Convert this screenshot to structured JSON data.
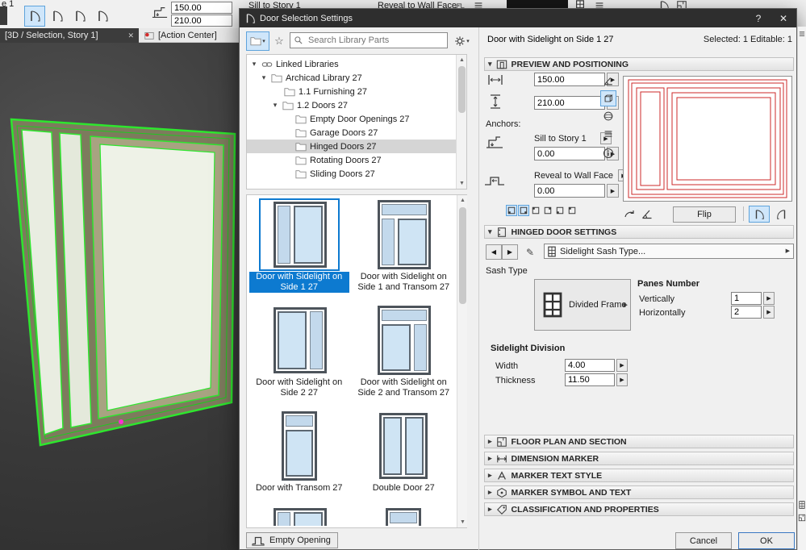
{
  "icons": {
    "chevron_down": "▾",
    "chevron_right": "▸",
    "arrow_left": "◀",
    "arrow_right": "▶",
    "flyout": "▶",
    "star": "☆",
    "pencil": "✎",
    "scroll_up": "▲",
    "scroll_down": "▼"
  },
  "topbar": {
    "corner_label": "e 1",
    "width_value": "150.00",
    "height_value": "210.00",
    "sill_label": "Sill to Story 1",
    "reveal_label": "Reveal to Wall Face"
  },
  "viewport": {
    "tab_label": "[3D / Selection, Story 1]",
    "tab_close": "✕",
    "action_center_label": "[Action Center]"
  },
  "dialog": {
    "title": "Door Selection Settings",
    "help_label": "?",
    "close_label": "✕"
  },
  "library": {
    "search_placeholder": "Search Library Parts",
    "tree": [
      {
        "label": "Linked Libraries"
      },
      {
        "label": "Archicad Library 27"
      },
      {
        "label": "1.1 Furnishing 27"
      },
      {
        "label": "1.2 Doors 27"
      },
      {
        "label": "Empty Door Openings 27"
      },
      {
        "label": "Garage Doors 27"
      },
      {
        "label": "Hinged Doors 27"
      },
      {
        "label": "Rotating Doors 27"
      },
      {
        "label": "Sliding Doors 27"
      }
    ],
    "items": [
      {
        "label": "Door with Sidelight on Side 1 27"
      },
      {
        "label": "Door with Sidelight on Side 1 and Transom 27"
      },
      {
        "label": "Door with Sidelight on Side 2 27"
      },
      {
        "label": "Door with Sidelight on Side 2 and Transom 27"
      },
      {
        "label": "Door with Transom 27"
      },
      {
        "label": "Double Door 27"
      }
    ],
    "empty_opening_label": "Empty Opening"
  },
  "settings": {
    "header_title": "Door with Sidelight on Side 1 27",
    "selection_info": "Selected: 1 Editable: 1",
    "sections": {
      "preview": "PREVIEW AND POSITIONING",
      "hinged": "HINGED DOOR SETTINGS",
      "floor_plan": "FLOOR PLAN AND SECTION",
      "dimension": "DIMENSION MARKER",
      "marker_text": "MARKER TEXT STYLE",
      "marker_symbol": "MARKER SYMBOL AND TEXT",
      "classification": "CLASSIFICATION AND PROPERTIES"
    },
    "preview": {
      "width_value": "150.00",
      "height_value": "210.00",
      "anchors_label": "Anchors:",
      "sill_anchor_label": "Sill to Story 1",
      "sill_value": "0.00",
      "reveal_anchor_label": "Reveal to Wall Face",
      "reveal_value": "0.00",
      "flip_label": "Flip"
    },
    "hinged": {
      "sash_dropdown_label": "Sidelight Sash Type...",
      "sash_type_label": "Sash Type",
      "sash_name": "Divided Frame",
      "panes_number_label": "Panes Number",
      "vertically_label": "Vertically",
      "vertically_value": "1",
      "horizontally_label": "Horizontally",
      "horizontally_value": "2",
      "sidelight_division_label": "Sidelight Division",
      "width_label": "Width",
      "width_value": "4.00",
      "thickness_label": "Thickness",
      "thickness_value": "11.50"
    },
    "cancel_label": "Cancel",
    "ok_label": "OK"
  }
}
